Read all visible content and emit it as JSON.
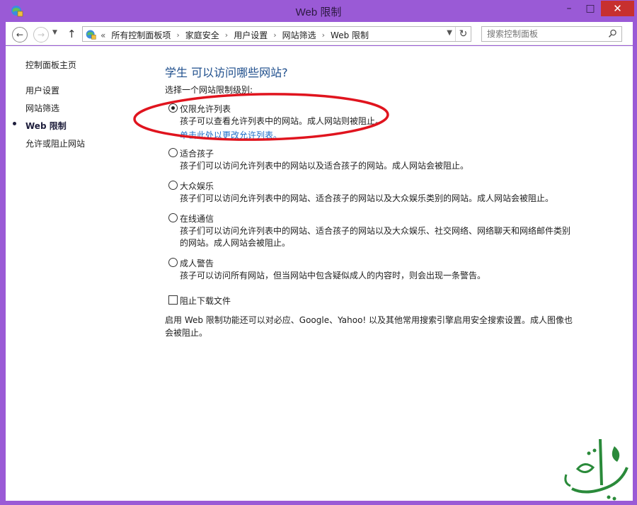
{
  "window": {
    "title": "Web 限制",
    "controls": {
      "minimize": "–",
      "maximize": "□",
      "close": "✕"
    }
  },
  "nav": {
    "back_icon": "arrow-left-icon",
    "forward_icon": "arrow-right-icon",
    "recent_icon": "chevron-down-icon",
    "up_icon": "arrow-up-icon",
    "breadcrumb_prefix": "«",
    "breadcrumb": [
      "所有控制面板项",
      "家庭安全",
      "用户设置",
      "网站筛选",
      "Web 限制"
    ],
    "search_placeholder": "搜索控制面板"
  },
  "sidebar": {
    "home": "控制面板主页",
    "items": [
      {
        "label": "用户设置",
        "active": false
      },
      {
        "label": "网站筛选",
        "active": false
      },
      {
        "label": "Web 限制",
        "active": true
      },
      {
        "label": "允许或阻止网站",
        "active": false
      }
    ]
  },
  "main": {
    "heading": "学生 可以访问哪些网站?",
    "subheading": "选择一个网站限制级别:",
    "options": [
      {
        "label": "仅限允许列表",
        "desc": "孩子可以查看允许列表中的网站。成人网站则被阻止。",
        "link": "单击此处以更改允许列表。",
        "checked": true
      },
      {
        "label": "适合孩子",
        "desc": "孩子们可以访问允许列表中的网站以及适合孩子的网站。成人网站会被阻止。",
        "checked": false
      },
      {
        "label": "大众娱乐",
        "desc": "孩子们可以访问允许列表中的网站、适合孩子的网站以及大众娱乐类别的网站。成人网站会被阻止。",
        "checked": false
      },
      {
        "label": "在线通信",
        "desc": "孩子们可以访问允许列表中的网站、适合孩子的网站以及大众娱乐、社交网络、网络聊天和网络邮件类别的网站。成人网站会被阻止。",
        "checked": false
      },
      {
        "label": "成人警告",
        "desc": "孩子可以访问所有网站，但当网站中包含疑似成人的内容时，则会出现一条警告。",
        "checked": false
      }
    ],
    "block_downloads": {
      "label": "阻止下载文件",
      "checked": false
    },
    "footer": "启用 Web 限制功能还可以对必应、Google、Yahoo! 以及其他常用搜索引擎启用安全搜索设置。成人图像也会被阻止。"
  },
  "colors": {
    "titlebar": "#9a5ad6",
    "close": "#c7302f",
    "heading": "#1e4e8c",
    "link": "#1e6ec8",
    "annotation": "#e0141e"
  }
}
